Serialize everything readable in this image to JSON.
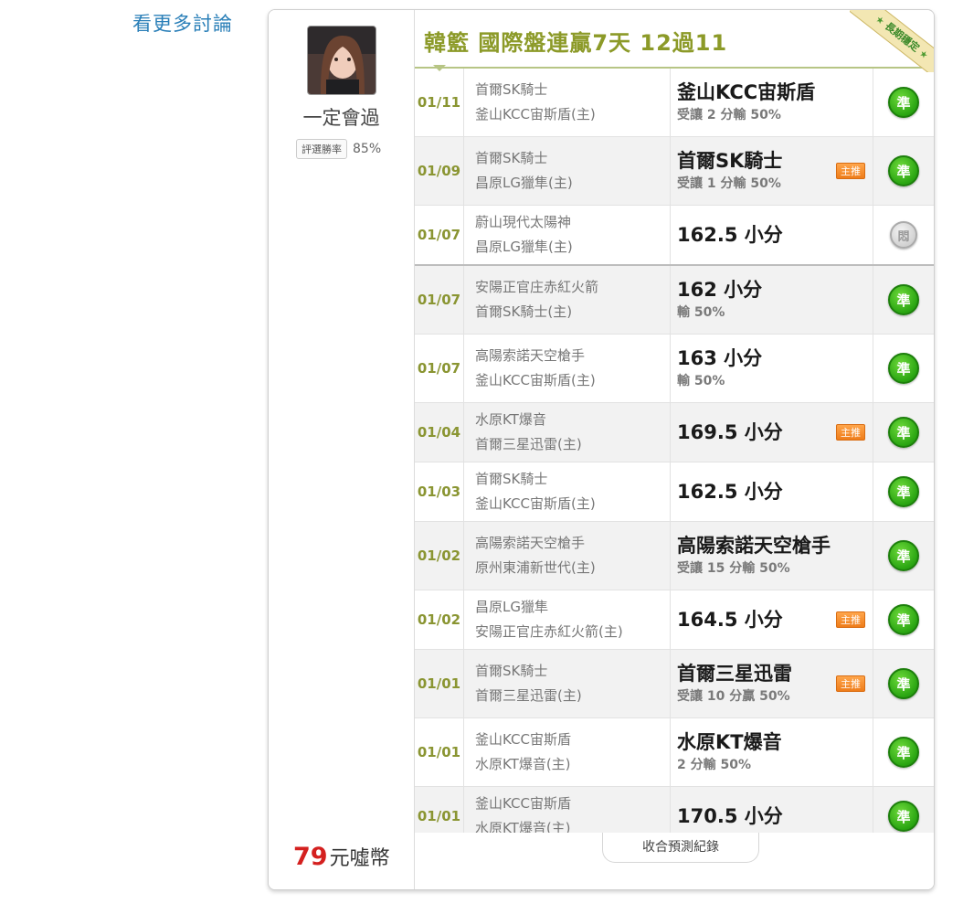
{
  "more_link": "看更多討論",
  "user": {
    "name": "一定會過",
    "rate_label": "評選勝率",
    "rate_value": "85%",
    "price_num": "79",
    "price_unit": "元噓幣"
  },
  "header": {
    "title": "韓籃 國際盤連贏7天 12過11",
    "ribbon": "長期穩定"
  },
  "rows": [
    {
      "date": "01/11",
      "team1": "首爾SK騎士",
      "team2": "釜山KCC宙斯盾(主)",
      "pick": "釜山KCC宙斯盾",
      "sub": "受讓 2 分輸 50%",
      "tag": "",
      "result": "準"
    },
    {
      "date": "01/09",
      "team1": "首爾SK騎士",
      "team2": "昌原LG獵隼(主)",
      "pick": "首爾SK騎士",
      "sub": "受讓 1 分輸 50%",
      "tag": "主推",
      "result": "準"
    },
    {
      "date": "01/07",
      "team1": "蔚山現代太陽神",
      "team2": "昌原LG獵隼(主)",
      "pick": "162.5 小分",
      "sub": "",
      "tag": "",
      "result": "悶"
    },
    {
      "date": "01/07",
      "team1": "安陽正官庄赤紅火箭",
      "team2": "首爾SK騎士(主)",
      "pick": "162 小分",
      "sub": "輸 50%",
      "tag": "",
      "result": "準"
    },
    {
      "date": "01/07",
      "team1": "高陽索諾天空槍手",
      "team2": "釜山KCC宙斯盾(主)",
      "pick": "163 小分",
      "sub": "輸 50%",
      "tag": "",
      "result": "準"
    },
    {
      "date": "01/04",
      "team1": "水原KT爆音",
      "team2": "首爾三星迅雷(主)",
      "pick": "169.5 小分",
      "sub": "",
      "tag": "主推",
      "result": "準"
    },
    {
      "date": "01/03",
      "team1": "首爾SK騎士",
      "team2": "釜山KCC宙斯盾(主)",
      "pick": "162.5 小分",
      "sub": "",
      "tag": "",
      "result": "準"
    },
    {
      "date": "01/02",
      "team1": "高陽索諾天空槍手",
      "team2": "原州東浦新世代(主)",
      "pick": "高陽索諾天空槍手",
      "sub": "受讓 15 分輸 50%",
      "tag": "",
      "result": "準"
    },
    {
      "date": "01/02",
      "team1": "昌原LG獵隼",
      "team2": "安陽正官庄赤紅火箭(主)",
      "pick": "164.5 小分",
      "sub": "",
      "tag": "主推",
      "result": "準"
    },
    {
      "date": "01/01",
      "team1": "首爾SK騎士",
      "team2": "首爾三星迅雷(主)",
      "pick": "首爾三星迅雷",
      "sub": "受讓 10 分贏 50%",
      "tag": "主推",
      "result": "準"
    },
    {
      "date": "01/01",
      "team1": "釜山KCC宙斯盾",
      "team2": "水原KT爆音(主)",
      "pick": "水原KT爆音",
      "sub": "2 分輸 50%",
      "tag": "",
      "result": "準"
    },
    {
      "date": "01/01",
      "team1": "釜山KCC宙斯盾",
      "team2": "水原KT爆音(主)",
      "pick": "170.5 小分",
      "sub": "",
      "tag": "",
      "result": "準"
    }
  ],
  "collapse_label": "收合預測紀錄"
}
